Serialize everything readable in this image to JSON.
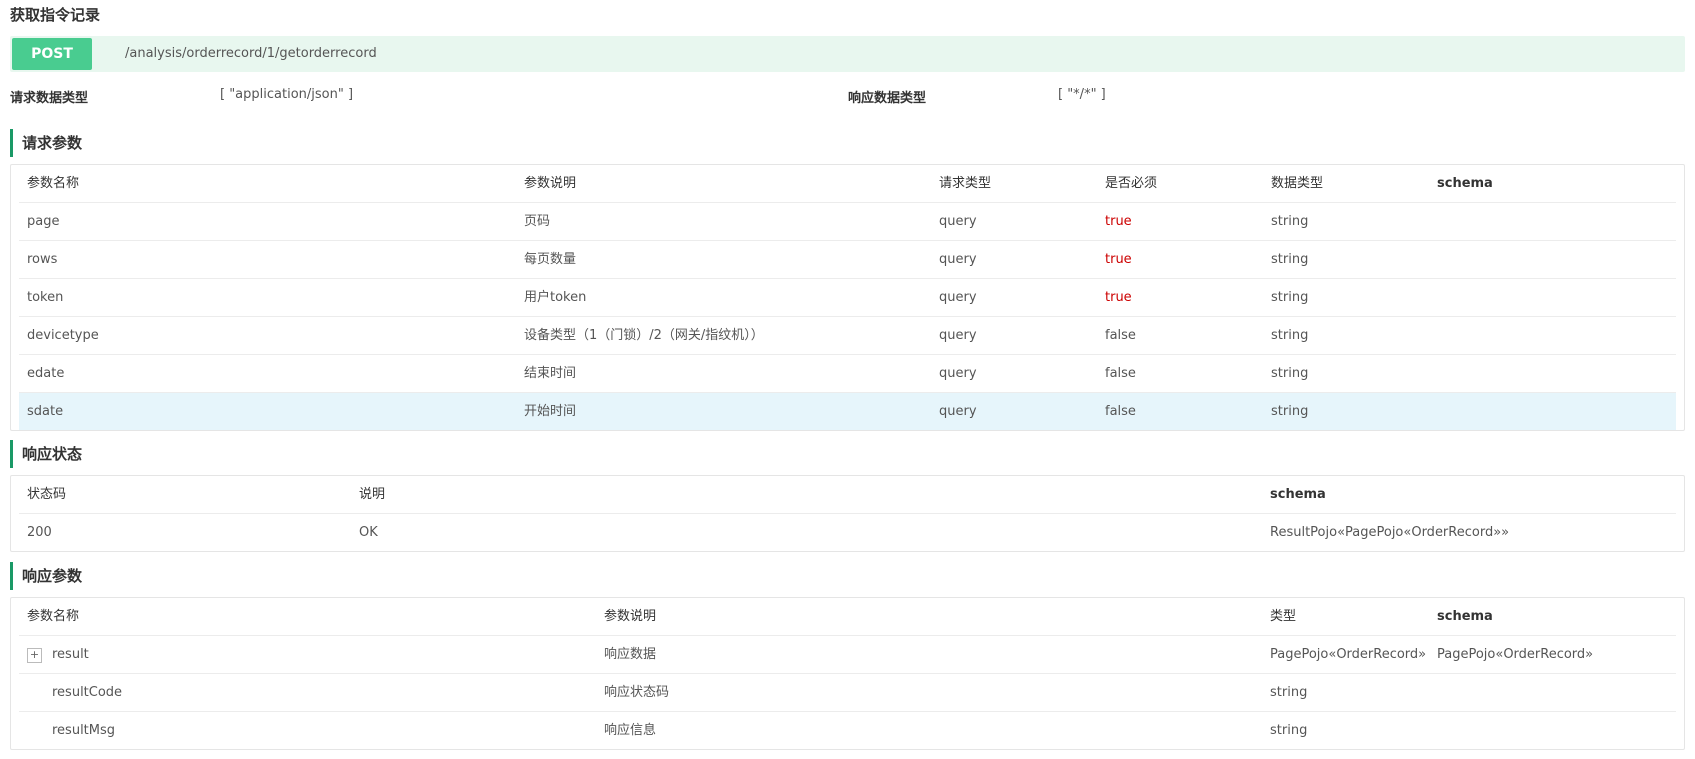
{
  "api": {
    "title": "获取指令记录",
    "method": "POST",
    "path": "/analysis/orderrecord/1/getorderrecord",
    "request_type_label": "请求数据类型",
    "request_type_value": "[ \"application/json\" ]",
    "response_type_label": "响应数据类型",
    "response_type_value": "[ \"*/*\" ]"
  },
  "request_params": {
    "title": "请求参数",
    "headers": [
      "参数名称",
      "参数说明",
      "请求类型",
      "是否必须",
      "数据类型",
      "schema"
    ],
    "rows": [
      {
        "name": "page",
        "desc": "页码",
        "in": "query",
        "required": "true",
        "type": "string",
        "schema": ""
      },
      {
        "name": "rows",
        "desc": "每页数量",
        "in": "query",
        "required": "true",
        "type": "string",
        "schema": ""
      },
      {
        "name": "token",
        "desc": "用户token",
        "in": "query",
        "required": "true",
        "type": "string",
        "schema": ""
      },
      {
        "name": "devicetype",
        "desc": "设备类型（1（门锁）/2（网关/指纹机））",
        "in": "query",
        "required": "false",
        "type": "string",
        "schema": ""
      },
      {
        "name": "edate",
        "desc": "结束时间",
        "in": "query",
        "required": "false",
        "type": "string",
        "schema": ""
      },
      {
        "name": "sdate",
        "desc": "开始时间",
        "in": "query",
        "required": "false",
        "type": "string",
        "schema": ""
      }
    ]
  },
  "response_status": {
    "title": "响应状态",
    "headers": [
      "状态码",
      "说明",
      "schema"
    ],
    "rows": [
      {
        "code": "200",
        "desc": "OK",
        "schema": "ResultPojo«PagePojo«OrderRecord»»"
      }
    ]
  },
  "response_params": {
    "title": "响应参数",
    "headers": [
      "参数名称",
      "参数说明",
      "类型",
      "schema"
    ],
    "expand_symbol": "+",
    "rows": [
      {
        "name": "result",
        "desc": "响应数据",
        "type": "PagePojo«OrderRecord»",
        "schema": "PagePojo«OrderRecord»"
      },
      {
        "name": "resultCode",
        "desc": "响应状态码",
        "type": "string",
        "schema": ""
      },
      {
        "name": "resultMsg",
        "desc": "响应信息",
        "type": "string",
        "schema": ""
      }
    ]
  },
  "colors": {
    "post_badge": "#49cc90",
    "post_bar": "#e8f7ef",
    "section_accent": "#1a9966",
    "required_true": "#cc0000",
    "row_highlight": "#e6f5fb"
  }
}
